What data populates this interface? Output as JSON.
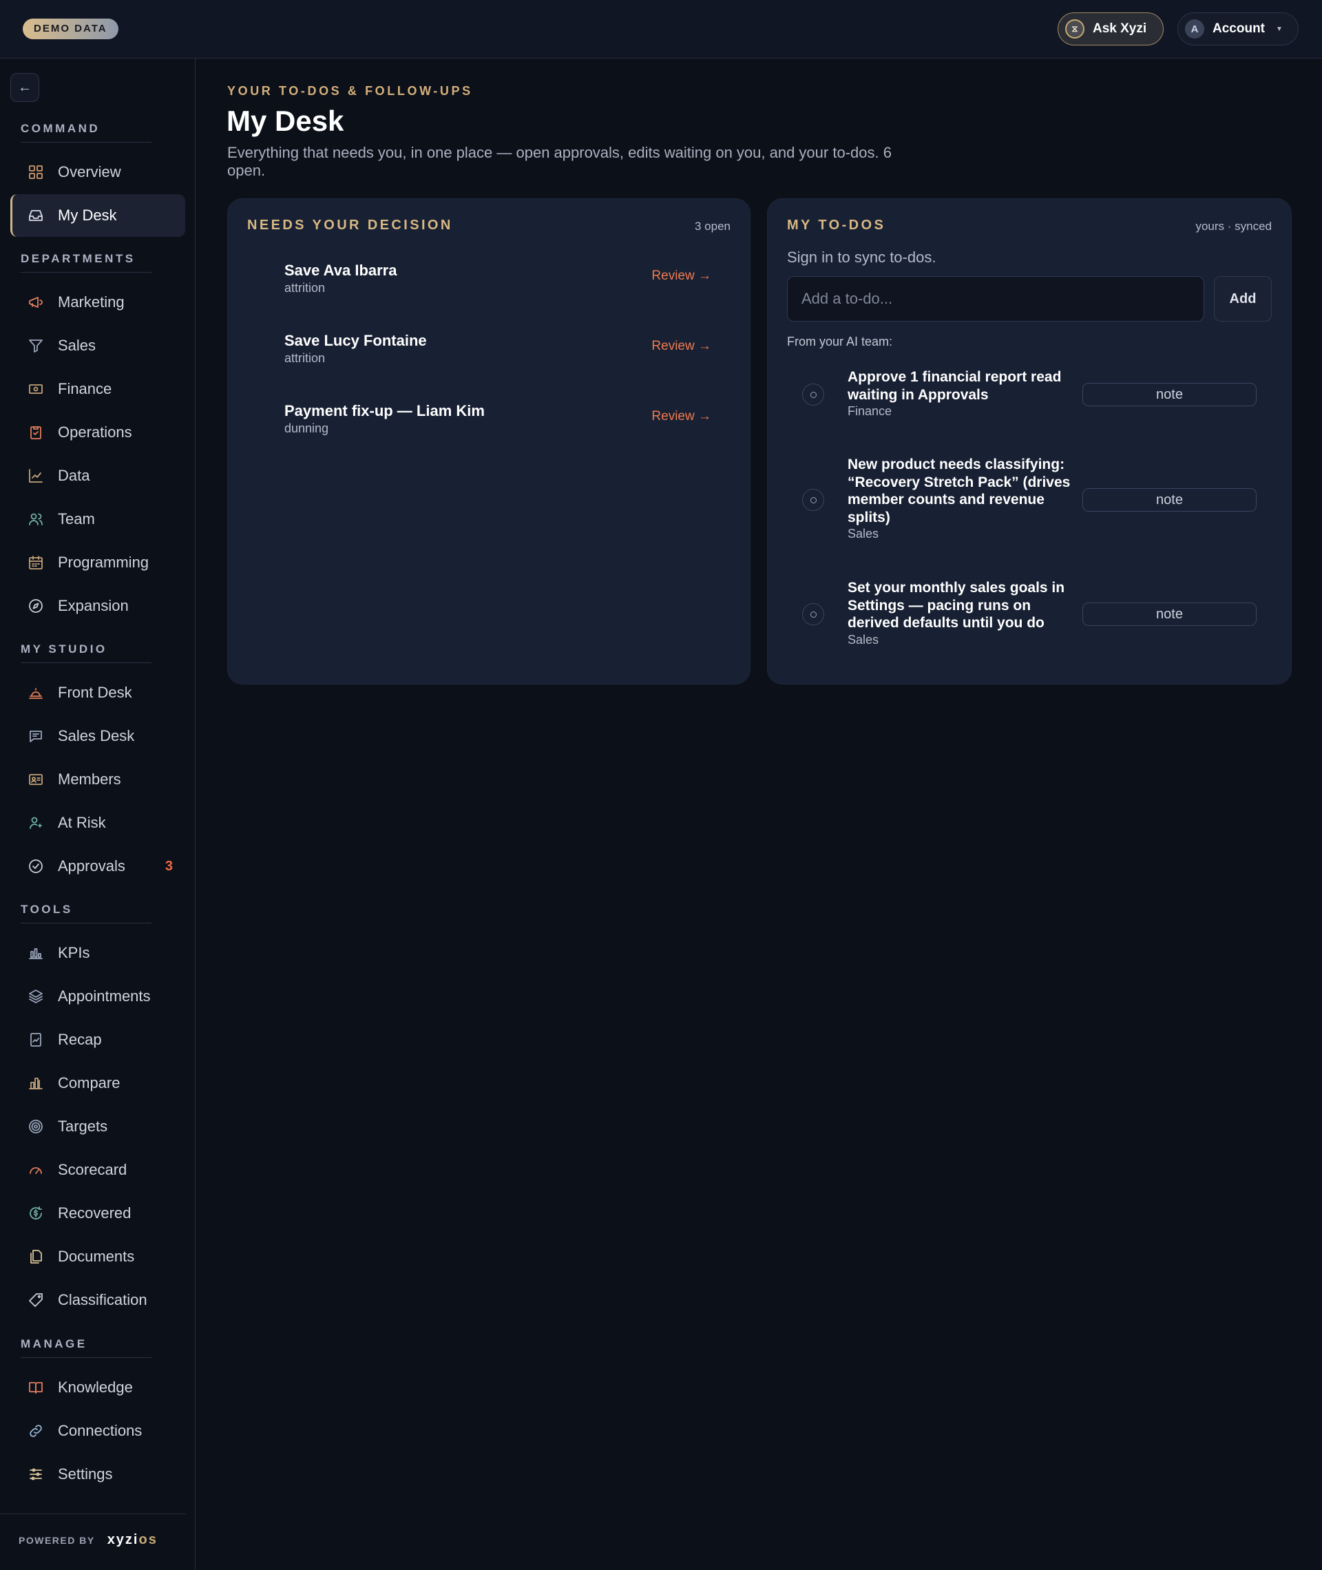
{
  "topbar": {
    "demo_badge": "DEMO DATA",
    "ask_label": "Ask Xyzi",
    "account_label": "Account",
    "avatar_initial": "A"
  },
  "sidebar": {
    "sections": {
      "command": "COMMAND",
      "departments": "DEPARTMENTS",
      "my_studio": "MY STUDIO",
      "tools": "TOOLS",
      "manage": "MANAGE"
    },
    "items": {
      "overview": {
        "label": "Overview",
        "icon": "grid-icon"
      },
      "my_desk": {
        "label": "My Desk",
        "icon": "inbox-icon",
        "active": true
      },
      "marketing": {
        "label": "Marketing",
        "icon": "megaphone-icon"
      },
      "sales": {
        "label": "Sales",
        "icon": "funnel-icon"
      },
      "finance": {
        "label": "Finance",
        "icon": "banknote-icon"
      },
      "operations": {
        "label": "Operations",
        "icon": "clipboard-check-icon"
      },
      "data": {
        "label": "Data",
        "icon": "line-chart-icon"
      },
      "team": {
        "label": "Team",
        "icon": "users-icon"
      },
      "programming": {
        "label": "Programming",
        "icon": "calendar-icon"
      },
      "expansion": {
        "label": "Expansion",
        "icon": "compass-icon"
      },
      "front_desk": {
        "label": "Front Desk",
        "icon": "bell-icon"
      },
      "sales_desk": {
        "label": "Sales Desk",
        "icon": "chat-icon"
      },
      "members": {
        "label": "Members",
        "icon": "id-card-icon"
      },
      "at_risk": {
        "label": "At Risk",
        "icon": "user-alert-icon"
      },
      "approvals": {
        "label": "Approvals",
        "icon": "check-circle-icon",
        "badge": "3"
      },
      "kpis": {
        "label": "KPIs",
        "icon": "bar-chart-icon"
      },
      "appointments": {
        "label": "Appointments",
        "icon": "layers-icon"
      },
      "recap": {
        "label": "Recap",
        "icon": "report-icon"
      },
      "compare": {
        "label": "Compare",
        "icon": "columns-chart-icon"
      },
      "targets": {
        "label": "Targets",
        "icon": "target-icon"
      },
      "scorecard": {
        "label": "Scorecard",
        "icon": "gauge-icon"
      },
      "recovered": {
        "label": "Recovered",
        "icon": "refresh-dollar-icon"
      },
      "documents": {
        "label": "Documents",
        "icon": "files-icon"
      },
      "classification": {
        "label": "Classification",
        "icon": "tag-icon"
      },
      "knowledge": {
        "label": "Knowledge",
        "icon": "book-icon"
      },
      "connections": {
        "label": "Connections",
        "icon": "link-icon"
      },
      "settings": {
        "label": "Settings",
        "icon": "sliders-icon"
      }
    },
    "powered_label": "POWERED BY",
    "brand_main": "xyzi",
    "brand_suffix": "os"
  },
  "header": {
    "eyebrow": "YOUR TO-DOS & FOLLOW-UPS",
    "title": "My Desk",
    "description": "Everything that needs you, in one place — open approvals, edits waiting on you, and your to-dos. 6 open."
  },
  "decisions": {
    "title": "NEEDS YOUR DECISION",
    "count": "3 open",
    "items": [
      {
        "name": "Save Ava Ibarra",
        "type": "attrition",
        "action": "Review →"
      },
      {
        "name": "Save Lucy Fontaine",
        "type": "attrition",
        "action": "Review →"
      },
      {
        "name": "Payment fix-up — Liam Kim",
        "type": "dunning",
        "action": "Review →"
      }
    ]
  },
  "todos": {
    "title": "MY TO-DOS",
    "meta": "yours · synced",
    "signin_message": "Sign in to sync to-dos.",
    "input_placeholder": "Add a to-do...",
    "add_label": "Add",
    "from_ai_label": "From your AI team:",
    "items": [
      {
        "title": "Approve 1 financial report read waiting in Approvals",
        "dept": "Finance",
        "note_label": "note"
      },
      {
        "title": "New product needs classifying: “Recovery Stretch Pack” (drives member counts and revenue splits)",
        "dept": "Sales",
        "note_label": "note"
      },
      {
        "title": "Set your monthly sales goals in Settings — pacing runs on derived defaults until you do",
        "dept": "Sales",
        "note_label": "note"
      }
    ]
  },
  "colors": {
    "accent_gold": "#d4b07c",
    "alert_orange": "#ef7b4f",
    "icon_orange": "#e07e5a",
    "icon_teal": "#6fb1a4",
    "background": "#0c1019",
    "card": "#182033"
  }
}
